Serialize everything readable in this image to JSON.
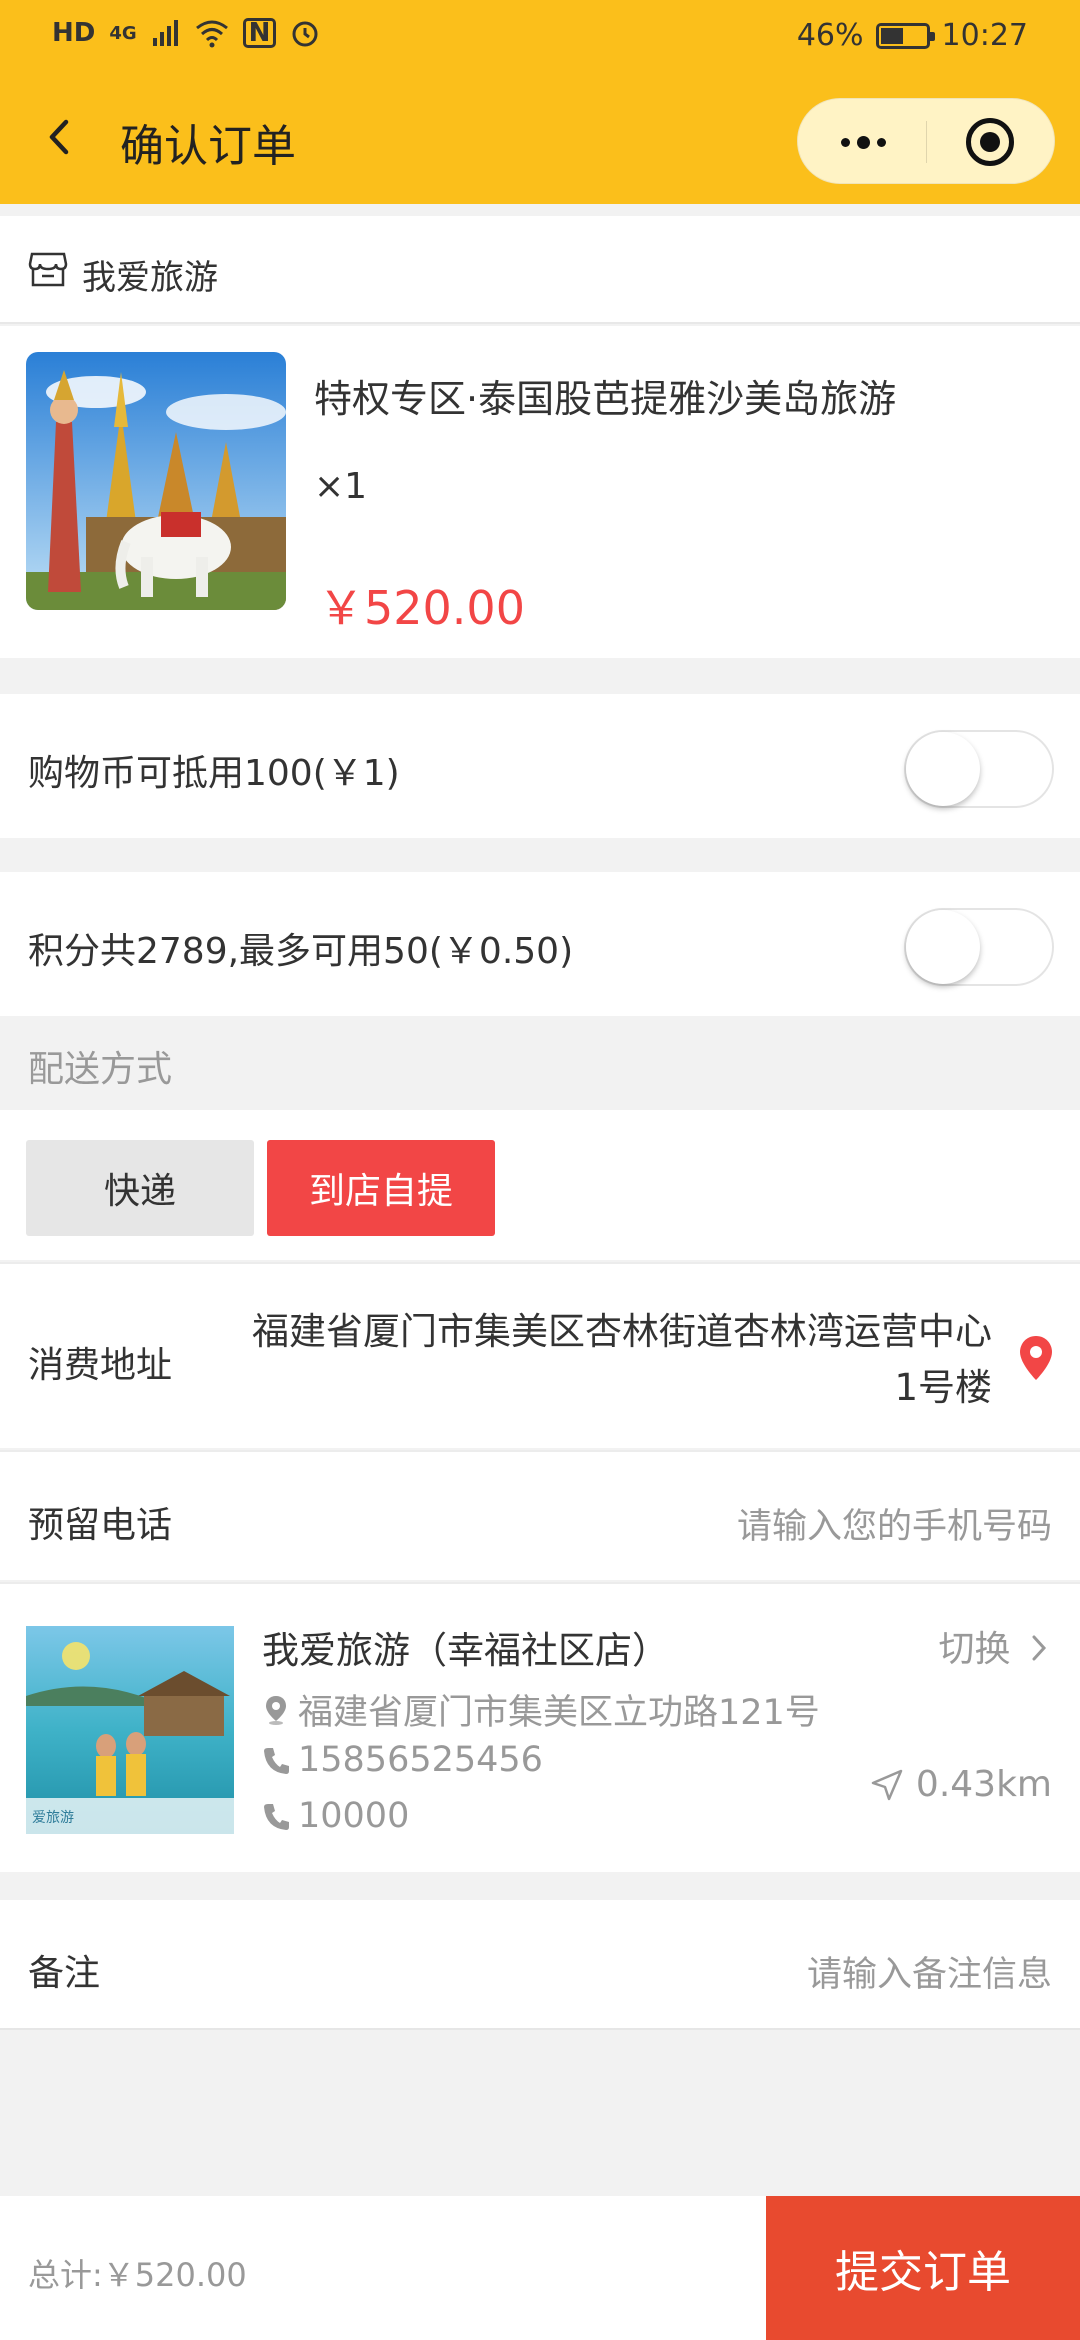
{
  "status_bar": {
    "hd": "HD",
    "network": "4G",
    "nfc": "N",
    "battery_pct_text": "46%",
    "battery_level": 0.46,
    "time": "10:27"
  },
  "header": {
    "title": "确认订单"
  },
  "shop": {
    "name": "我爱旅游"
  },
  "product": {
    "title": "特权专区·泰国股芭提雅沙美岛旅游",
    "qty": "×1",
    "price": "￥520.00"
  },
  "shopping_coins": {
    "label": "购物币可抵用100(￥1)",
    "enabled": false
  },
  "points": {
    "label": "积分共2789,最多可用50(￥0.50)",
    "enabled": false
  },
  "delivery": {
    "section_label": "配送方式",
    "express_label": "快递",
    "pickup_label": "到店自提",
    "selected": "pickup"
  },
  "address": {
    "label": "消费地址",
    "value": "福建省厦门市集美区杏林街道杏林湾运营中心1号楼"
  },
  "phone": {
    "label": "预留电话",
    "placeholder": "请输入您的手机号码"
  },
  "store": {
    "name": "我爱旅游（幸福社区店）",
    "switch_label": "切换",
    "address": "福建省厦门市集美区立功路121号",
    "phone1": "15856525456",
    "phone2": "10000",
    "distance": "0.43km"
  },
  "remark": {
    "label": "备注",
    "placeholder": "请输入备注信息"
  },
  "footer": {
    "total": "总计:￥520.00",
    "submit_label": "提交订单"
  },
  "colors": {
    "header_bg": "#fbbf1b",
    "price_red": "#f24646",
    "submit_bg": "#e84a2f"
  }
}
